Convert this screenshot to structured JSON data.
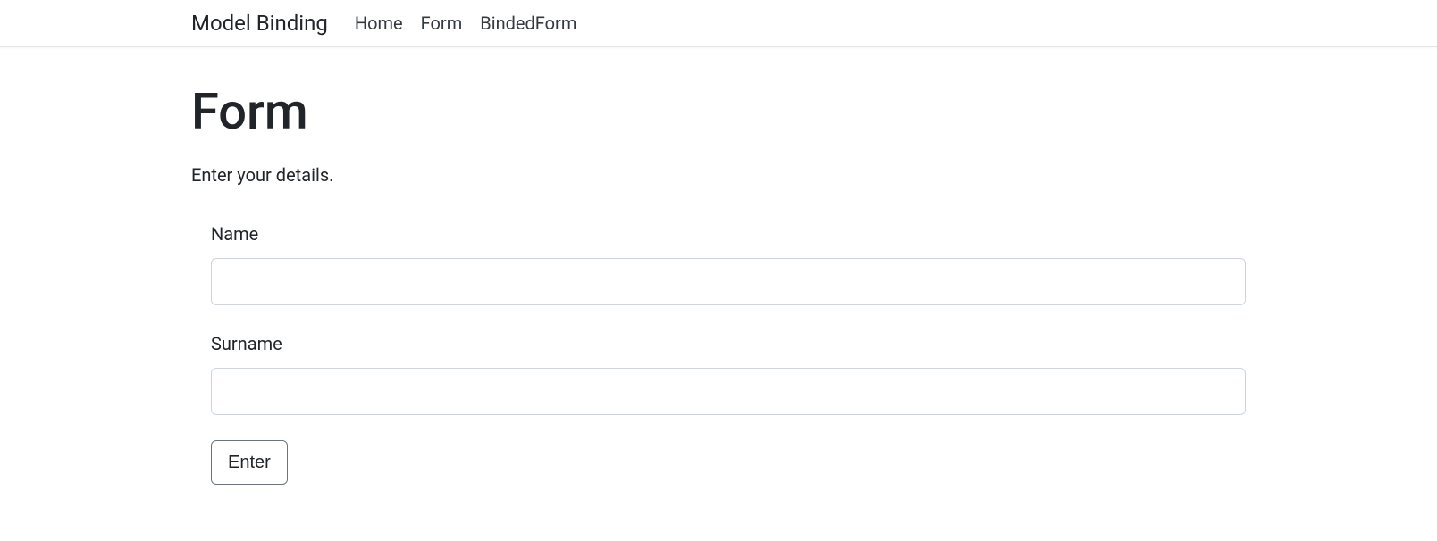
{
  "navbar": {
    "brand": "Model Binding",
    "links": [
      {
        "label": "Home"
      },
      {
        "label": "Form"
      },
      {
        "label": "BindedForm"
      }
    ]
  },
  "page": {
    "title": "Form",
    "subtitle": "Enter your details."
  },
  "form": {
    "fields": {
      "name": {
        "label": "Name",
        "value": ""
      },
      "surname": {
        "label": "Surname",
        "value": ""
      }
    },
    "submit_label": "Enter"
  }
}
